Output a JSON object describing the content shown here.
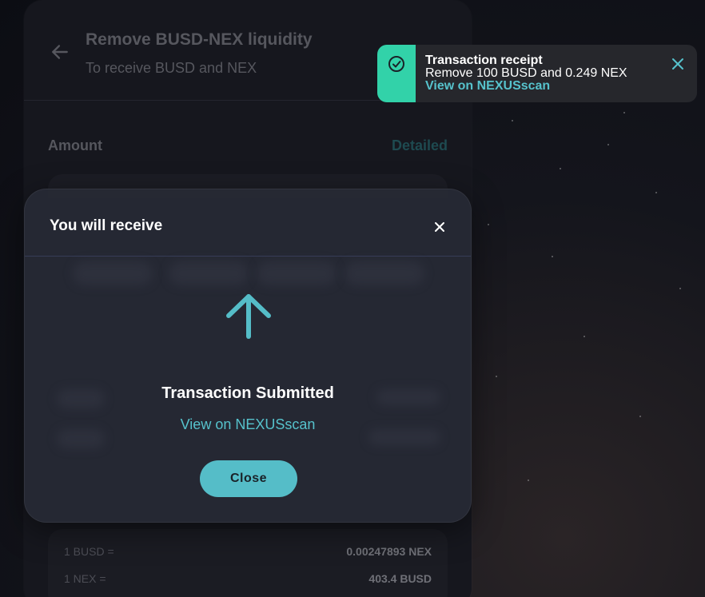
{
  "page": {
    "title": "Remove BUSD-NEX liquidity",
    "subtitle": "To receive BUSD and NEX",
    "amount_label": "Amount",
    "detailed_link": "Detailed"
  },
  "rates": [
    {
      "label": "1 BUSD =",
      "value": "0.00247893 NEX"
    },
    {
      "label": "1 NEX =",
      "value": "403.4 BUSD"
    }
  ],
  "modal": {
    "title": "You will receive",
    "status_title": "Transaction Submitted",
    "explorer_link": "View on NEXUSscan",
    "close_label": "Close",
    "icon": "arrow-up-icon"
  },
  "toast": {
    "title": "Transaction receipt",
    "message": "Remove 100 BUSD and 0.249 NEX",
    "link": "View on NEXUSscan",
    "icon": "check-circle-icon"
  },
  "colors": {
    "accent": "#55bdc8",
    "success": "#32d2a9",
    "background": "#0c0d13",
    "modal": "#262a34"
  }
}
